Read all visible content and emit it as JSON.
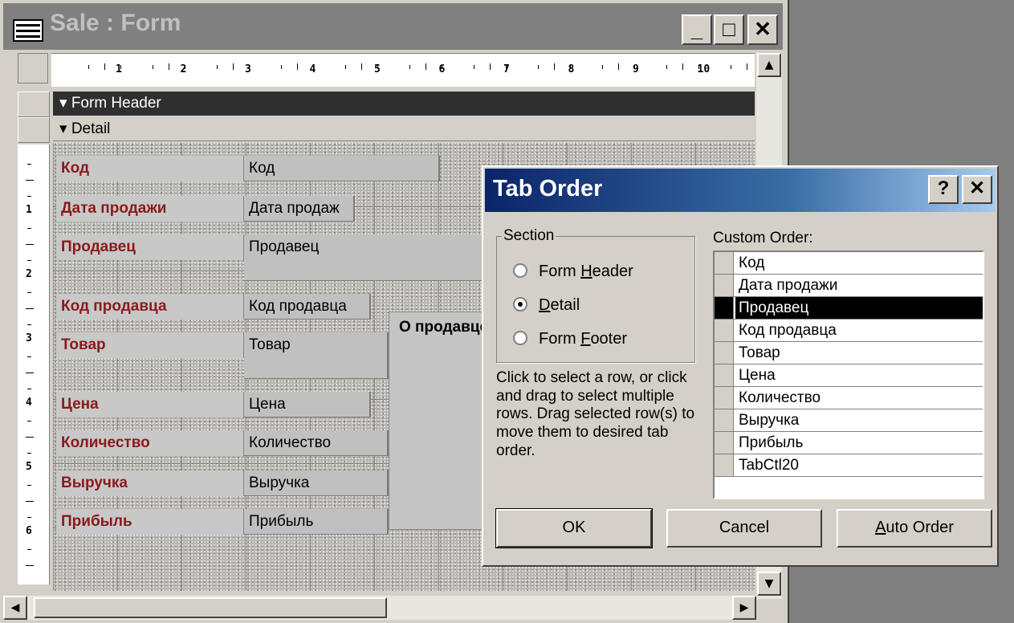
{
  "form_window": {
    "title": "Sale : Form",
    "controls": {
      "minimize": "_",
      "maximize": "□",
      "close": "✕"
    }
  },
  "ruler": {
    "horizontal": [
      "1",
      "2",
      "3",
      "4",
      "5",
      "6",
      "7",
      "8",
      "9",
      "10"
    ],
    "vertical": [
      "1",
      "2",
      "3",
      "4",
      "5",
      "6"
    ]
  },
  "sections": {
    "form_header": "Form Header",
    "detail": "Detail"
  },
  "fields": [
    {
      "label": "Код",
      "control": "Код"
    },
    {
      "label": "Дата продажи",
      "control": "Дата продаж"
    },
    {
      "label": "Продавец",
      "control": "Продавец"
    },
    {
      "label": "Код продавца",
      "control": "Код продавца"
    },
    {
      "label": "Товар",
      "control": "Товар"
    },
    {
      "label": "Цена",
      "control": "Цена"
    },
    {
      "label": "Количество",
      "control": "Количество"
    },
    {
      "label": "Выручка",
      "control": "Выручка"
    },
    {
      "label": "Прибыль",
      "control": "Прибыль"
    }
  ],
  "tab_control_label": "О продавце",
  "dialog": {
    "title": "Tab Order",
    "help": "?",
    "close": "✕",
    "section_group": "Section",
    "radio": {
      "form_header": "Form ",
      "form_header_key": "H",
      "form_header_rest": "eader",
      "detail_key": "D",
      "detail_rest": "etail",
      "form_footer": "Form ",
      "form_footer_key": "F",
      "form_footer_rest": "ooter",
      "selected": "Detail"
    },
    "instructions": "Click to select a row, or click and drag to select multiple rows.  Drag selected row(s) to move them to desired tab order.",
    "custom_order_label": "Custom Order:",
    "custom_order": [
      "Код",
      "Дата продажи",
      "Продавец",
      "Код продавца",
      "Товар",
      "Цена",
      "Количество",
      "Выручка",
      "Прибыль",
      "TabCtl20"
    ],
    "selected_item": "Продавец",
    "buttons": {
      "ok": "OK",
      "cancel": "Cancel",
      "auto_order_key": "A",
      "auto_order_rest": "uto Order"
    }
  }
}
